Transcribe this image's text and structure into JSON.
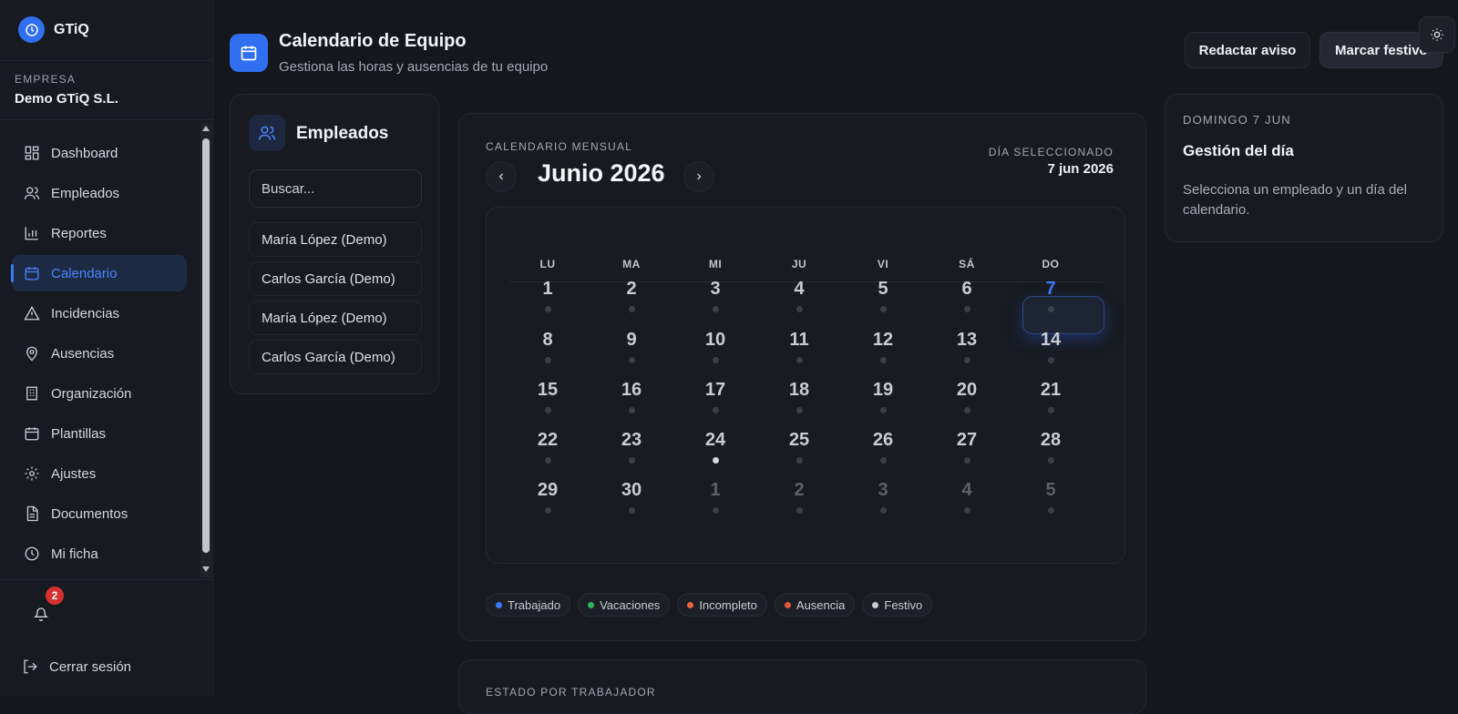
{
  "sidebar": {
    "brand": "GTiQ",
    "company_label": "EMPRESA",
    "company_name": "Demo GTiQ S.L.",
    "items": [
      {
        "label": "Dashboard",
        "icon": "dashboard-icon"
      },
      {
        "label": "Empleados",
        "icon": "users-icon"
      },
      {
        "label": "Reportes",
        "icon": "bar-chart-icon"
      },
      {
        "label": "Calendario",
        "icon": "calendar-icon",
        "active": true
      },
      {
        "label": "Incidencias",
        "icon": "warning-icon"
      },
      {
        "label": "Ausencias",
        "icon": "map-pin-icon"
      },
      {
        "label": "Organización",
        "icon": "building-icon"
      },
      {
        "label": "Plantillas",
        "icon": "calendar-template-icon"
      },
      {
        "label": "Ajustes",
        "icon": "gear-icon"
      },
      {
        "label": "Documentos",
        "icon": "document-icon"
      },
      {
        "label": "Mi ficha",
        "icon": "clock-icon"
      }
    ],
    "notifications_count": "2",
    "logout_label": "Cerrar sesión"
  },
  "header": {
    "title": "Calendario de Equipo",
    "subtitle": "Gestiona las horas y ausencias de tu equipo",
    "btn_aviso": "Redactar aviso",
    "btn_festivo": "Marcar festivo"
  },
  "employees": {
    "title": "Empleados",
    "search_placeholder": "Buscar...",
    "list": [
      "María López (Demo)",
      "Carlos García (Demo)",
      "María López (Demo)",
      "Carlos García (Demo)"
    ]
  },
  "calendar": {
    "label": "CALENDARIO MENSUAL",
    "month": "Junio 2026",
    "selected_label": "DÍA SELECCIONADO",
    "selected_value": "7 jun 2026",
    "weekdays": [
      "LU",
      "MA",
      "MI",
      "JU",
      "VI",
      "SÁ",
      "DO"
    ],
    "weeks": [
      [
        "1",
        "2",
        "3",
        "4",
        "5",
        "6",
        "7"
      ],
      [
        "8",
        "9",
        "10",
        "11",
        "12",
        "13",
        "14"
      ],
      [
        "15",
        "16",
        "17",
        "18",
        "19",
        "20",
        "21"
      ],
      [
        "22",
        "23",
        "24",
        "25",
        "26",
        "27",
        "28"
      ],
      [
        "29",
        "30",
        "1",
        "2",
        "3",
        "4",
        "5"
      ]
    ],
    "selected_day": "7",
    "marked_day": "24",
    "legend": [
      {
        "label": "Trabajado",
        "color": "#3a7af5"
      },
      {
        "label": "Vacaciones",
        "color": "#2fb45a"
      },
      {
        "label": "Incompleto",
        "color": "#e8643c"
      },
      {
        "label": "Ausencia",
        "color": "#e05a3a"
      },
      {
        "label": "Festivo",
        "color": "#c9ccd3"
      }
    ]
  },
  "day_panel": {
    "date_label": "DOMINGO 7 JUN",
    "title": "Gestión del día",
    "text": "Selecciona un empleado y un día del calendario."
  },
  "estado": {
    "label": "ESTADO POR TRABAJADOR"
  }
}
